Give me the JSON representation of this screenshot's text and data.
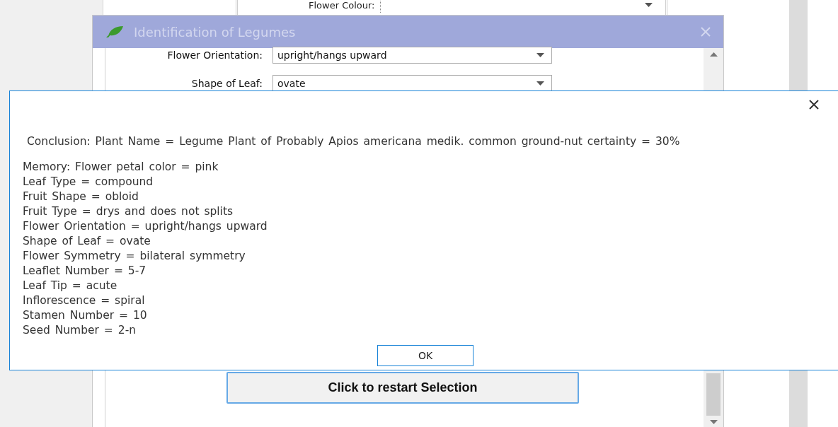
{
  "background_form": {
    "label": "Flower Colour:"
  },
  "window": {
    "title": "Identification of Legumes",
    "fields": [
      {
        "label": "Flower Orientation:",
        "value": "upright/hangs upward"
      },
      {
        "label": "Shape of Leaf:",
        "value": "ovate"
      }
    ],
    "restart_button": "Click to restart Selection"
  },
  "message_box": {
    "conclusion": "Conclusion: Plant Name = Legume Plant of Probably Apios americana medik. common ground-nut certainty = 30%",
    "memory": [
      "Memory: Flower petal color = pink",
      "Leaf Type = compound",
      "Fruit Shape = obloid",
      "Fruit Type = drys and does not splits",
      "Flower Orientation = upright/hangs upward",
      "Shape of Leaf = ovate",
      "Flower Symmetry = bilateral symmetry",
      "Leaflet Number = 5-7",
      "Leaf Tip = acute",
      "Inflorescence = spiral",
      "Stamen Number = 10",
      "Seed Number = 2-n"
    ],
    "ok_button": "OK"
  }
}
